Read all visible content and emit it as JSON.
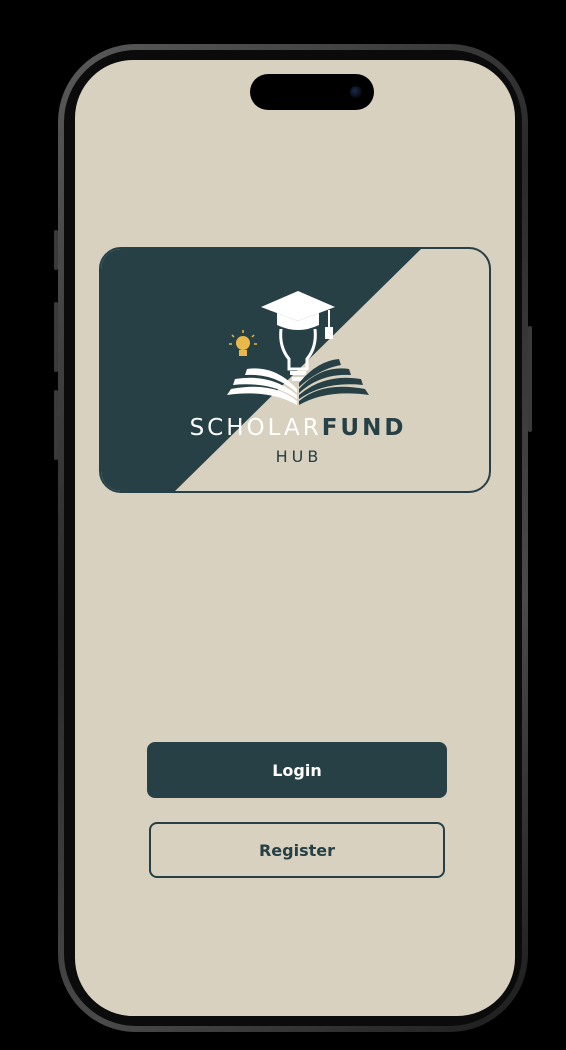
{
  "logo": {
    "brand_light": "SCHOLAR",
    "brand_bold": "FUND",
    "brand_sub": "HUB"
  },
  "actions": {
    "login_label": "Login",
    "register_label": "Register"
  },
  "colors": {
    "screen_background": "#d9d1bf",
    "primary": "#264046",
    "bulb_accent": "#e8b84a",
    "on_primary": "#ffffff"
  },
  "icons": {
    "emblem": "graduation-cap-lightbulb-book-logo"
  }
}
